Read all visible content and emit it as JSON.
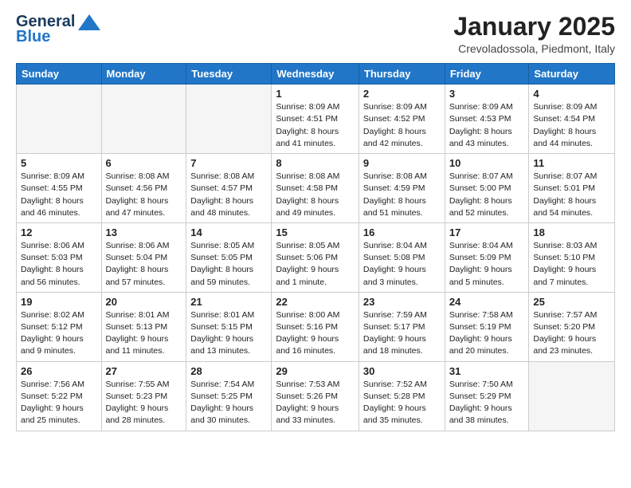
{
  "header": {
    "logo_line1": "General",
    "logo_line2": "Blue",
    "month": "January 2025",
    "location": "Crevoladossola, Piedmont, Italy"
  },
  "weekdays": [
    "Sunday",
    "Monday",
    "Tuesday",
    "Wednesday",
    "Thursday",
    "Friday",
    "Saturday"
  ],
  "weeks": [
    [
      {
        "day": "",
        "info": ""
      },
      {
        "day": "",
        "info": ""
      },
      {
        "day": "",
        "info": ""
      },
      {
        "day": "1",
        "info": "Sunrise: 8:09 AM\nSunset: 4:51 PM\nDaylight: 8 hours and 41 minutes."
      },
      {
        "day": "2",
        "info": "Sunrise: 8:09 AM\nSunset: 4:52 PM\nDaylight: 8 hours and 42 minutes."
      },
      {
        "day": "3",
        "info": "Sunrise: 8:09 AM\nSunset: 4:53 PM\nDaylight: 8 hours and 43 minutes."
      },
      {
        "day": "4",
        "info": "Sunrise: 8:09 AM\nSunset: 4:54 PM\nDaylight: 8 hours and 44 minutes."
      }
    ],
    [
      {
        "day": "5",
        "info": "Sunrise: 8:09 AM\nSunset: 4:55 PM\nDaylight: 8 hours and 46 minutes."
      },
      {
        "day": "6",
        "info": "Sunrise: 8:08 AM\nSunset: 4:56 PM\nDaylight: 8 hours and 47 minutes."
      },
      {
        "day": "7",
        "info": "Sunrise: 8:08 AM\nSunset: 4:57 PM\nDaylight: 8 hours and 48 minutes."
      },
      {
        "day": "8",
        "info": "Sunrise: 8:08 AM\nSunset: 4:58 PM\nDaylight: 8 hours and 49 minutes."
      },
      {
        "day": "9",
        "info": "Sunrise: 8:08 AM\nSunset: 4:59 PM\nDaylight: 8 hours and 51 minutes."
      },
      {
        "day": "10",
        "info": "Sunrise: 8:07 AM\nSunset: 5:00 PM\nDaylight: 8 hours and 52 minutes."
      },
      {
        "day": "11",
        "info": "Sunrise: 8:07 AM\nSunset: 5:01 PM\nDaylight: 8 hours and 54 minutes."
      }
    ],
    [
      {
        "day": "12",
        "info": "Sunrise: 8:06 AM\nSunset: 5:03 PM\nDaylight: 8 hours and 56 minutes."
      },
      {
        "day": "13",
        "info": "Sunrise: 8:06 AM\nSunset: 5:04 PM\nDaylight: 8 hours and 57 minutes."
      },
      {
        "day": "14",
        "info": "Sunrise: 8:05 AM\nSunset: 5:05 PM\nDaylight: 8 hours and 59 minutes."
      },
      {
        "day": "15",
        "info": "Sunrise: 8:05 AM\nSunset: 5:06 PM\nDaylight: 9 hours and 1 minute."
      },
      {
        "day": "16",
        "info": "Sunrise: 8:04 AM\nSunset: 5:08 PM\nDaylight: 9 hours and 3 minutes."
      },
      {
        "day": "17",
        "info": "Sunrise: 8:04 AM\nSunset: 5:09 PM\nDaylight: 9 hours and 5 minutes."
      },
      {
        "day": "18",
        "info": "Sunrise: 8:03 AM\nSunset: 5:10 PM\nDaylight: 9 hours and 7 minutes."
      }
    ],
    [
      {
        "day": "19",
        "info": "Sunrise: 8:02 AM\nSunset: 5:12 PM\nDaylight: 9 hours and 9 minutes."
      },
      {
        "day": "20",
        "info": "Sunrise: 8:01 AM\nSunset: 5:13 PM\nDaylight: 9 hours and 11 minutes."
      },
      {
        "day": "21",
        "info": "Sunrise: 8:01 AM\nSunset: 5:15 PM\nDaylight: 9 hours and 13 minutes."
      },
      {
        "day": "22",
        "info": "Sunrise: 8:00 AM\nSunset: 5:16 PM\nDaylight: 9 hours and 16 minutes."
      },
      {
        "day": "23",
        "info": "Sunrise: 7:59 AM\nSunset: 5:17 PM\nDaylight: 9 hours and 18 minutes."
      },
      {
        "day": "24",
        "info": "Sunrise: 7:58 AM\nSunset: 5:19 PM\nDaylight: 9 hours and 20 minutes."
      },
      {
        "day": "25",
        "info": "Sunrise: 7:57 AM\nSunset: 5:20 PM\nDaylight: 9 hours and 23 minutes."
      }
    ],
    [
      {
        "day": "26",
        "info": "Sunrise: 7:56 AM\nSunset: 5:22 PM\nDaylight: 9 hours and 25 minutes."
      },
      {
        "day": "27",
        "info": "Sunrise: 7:55 AM\nSunset: 5:23 PM\nDaylight: 9 hours and 28 minutes."
      },
      {
        "day": "28",
        "info": "Sunrise: 7:54 AM\nSunset: 5:25 PM\nDaylight: 9 hours and 30 minutes."
      },
      {
        "day": "29",
        "info": "Sunrise: 7:53 AM\nSunset: 5:26 PM\nDaylight: 9 hours and 33 minutes."
      },
      {
        "day": "30",
        "info": "Sunrise: 7:52 AM\nSunset: 5:28 PM\nDaylight: 9 hours and 35 minutes."
      },
      {
        "day": "31",
        "info": "Sunrise: 7:50 AM\nSunset: 5:29 PM\nDaylight: 9 hours and 38 minutes."
      },
      {
        "day": "",
        "info": ""
      }
    ]
  ]
}
